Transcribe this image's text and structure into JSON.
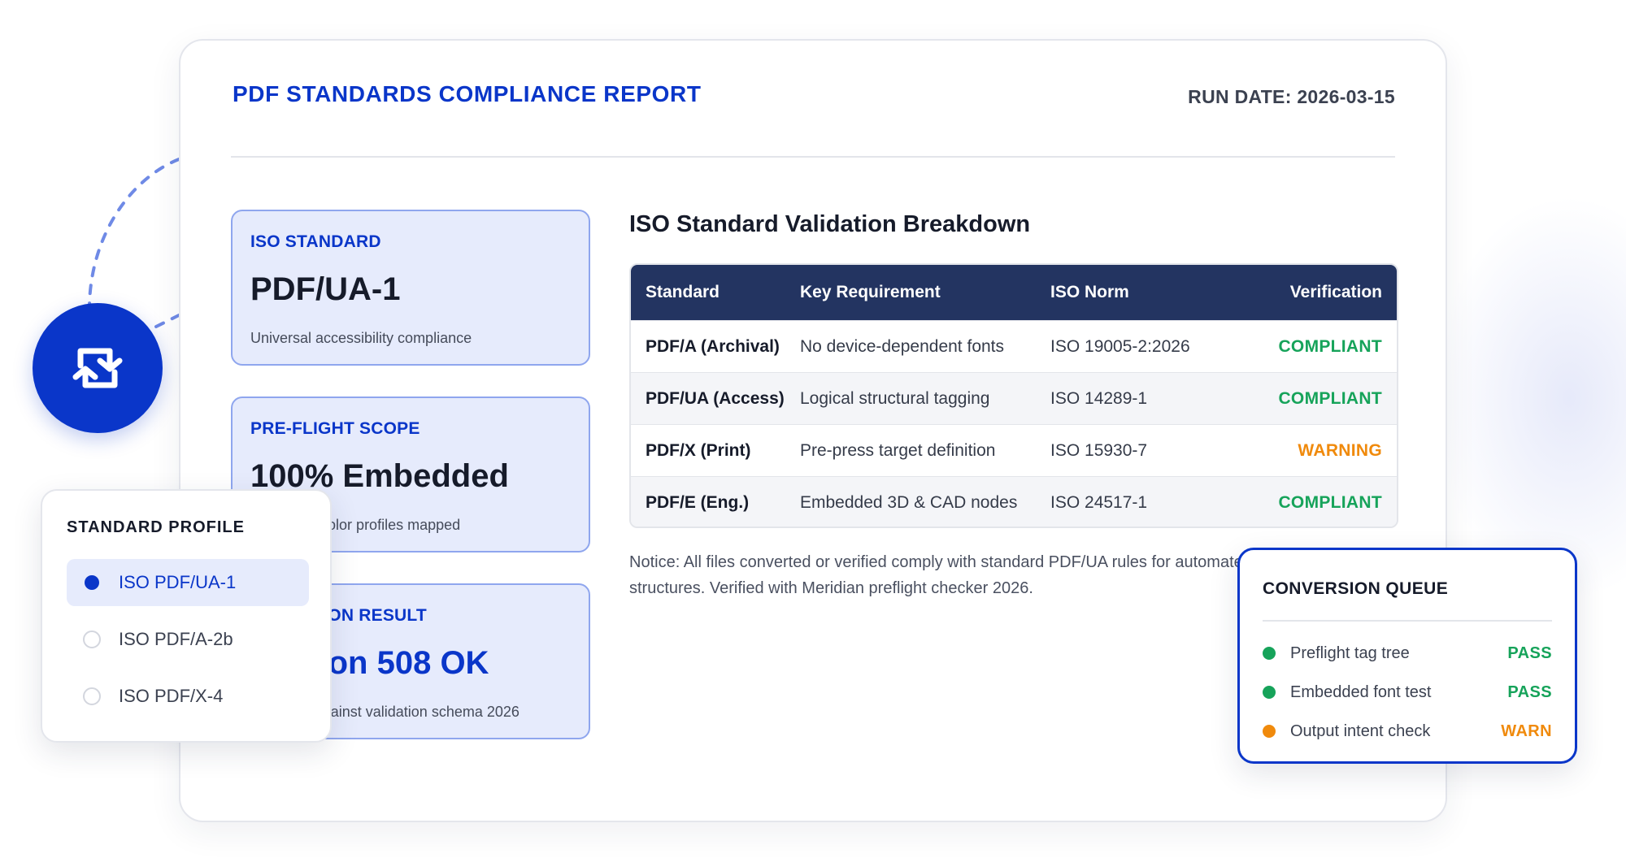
{
  "colors": {
    "accent": "#0a36c9",
    "table_header": "#233461",
    "pass": "#16a35a",
    "warn": "#f08a0c",
    "card_bg": "#e6ebfc"
  },
  "report": {
    "title": "PDF STANDARDS COMPLIANCE REPORT",
    "run_date": "RUN DATE: 2026-03-15"
  },
  "cards": [
    {
      "label": "ISO STANDARD",
      "value": "PDF/UA-1",
      "sub": "Universal accessibility compliance"
    },
    {
      "label": "PRE-FLIGHT SCOPE",
      "value": "100% Embedded",
      "sub": "All fonts & color profiles mapped"
    },
    {
      "label": "VALIDATION RESULT",
      "value": "Section 508 OK",
      "sub": "Validated against validation schema 2026"
    }
  ],
  "breakdown": {
    "title": "ISO Standard Validation Breakdown",
    "columns": [
      "Standard",
      "Key Requirement",
      "ISO Norm",
      "Verification"
    ],
    "rows": [
      {
        "standard": "PDF/A (Archival)",
        "requirement": "No device-dependent fonts",
        "norm": "ISO 19005-2:2026",
        "status": "COMPLIANT"
      },
      {
        "standard": "PDF/UA (Access)",
        "requirement": "Logical structural tagging",
        "norm": "ISO 14289-1",
        "status": "COMPLIANT"
      },
      {
        "standard": "PDF/X (Print)",
        "requirement": "Pre-press target definition",
        "norm": "ISO 15930-7",
        "status": "WARNING"
      },
      {
        "standard": "PDF/E (Eng.)",
        "requirement": "Embedded 3D & CAD nodes",
        "norm": "ISO 24517-1",
        "status": "COMPLIANT"
      }
    ],
    "notice_line1": "Notice: All files converted or verified comply with standard PDF/UA rules for automated",
    "notice_line2": "structures. Verified with Meridian preflight checker 2026."
  },
  "profile": {
    "title": "STANDARD PROFILE",
    "options": [
      {
        "label": "ISO PDF/UA-1",
        "selected": true
      },
      {
        "label": "ISO PDF/A-2b",
        "selected": false
      },
      {
        "label": "ISO PDF/X-4",
        "selected": false
      }
    ]
  },
  "queue": {
    "title": "CONVERSION QUEUE",
    "items": [
      {
        "label": "Preflight tag tree",
        "status": "PASS",
        "state": "pass"
      },
      {
        "label": "Embedded font test",
        "status": "PASS",
        "state": "pass"
      },
      {
        "label": "Output intent check",
        "status": "WARN",
        "state": "warn"
      }
    ]
  },
  "icons": {
    "sync": "sync-arrows-icon"
  }
}
